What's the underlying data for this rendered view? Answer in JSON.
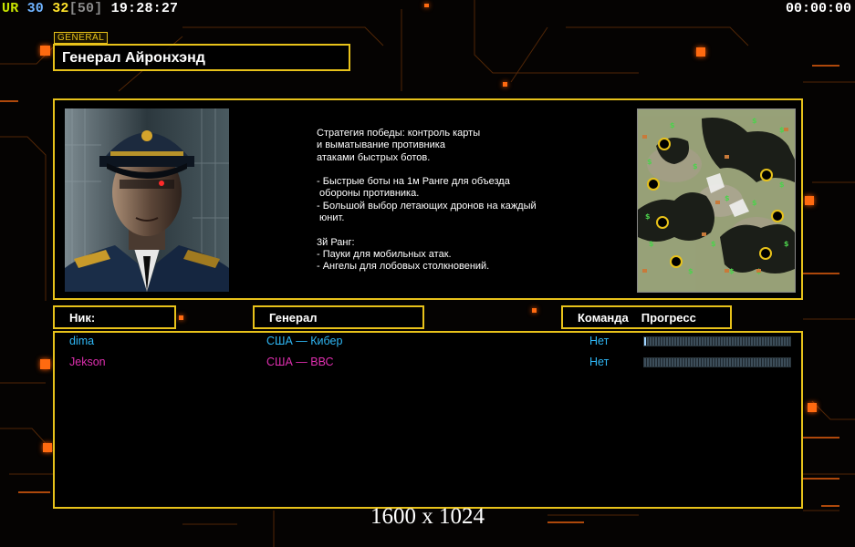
{
  "topbar": {
    "ur_label": "UR",
    "val_a": "30",
    "val_b": "32",
    "val_c": "[50]",
    "clock": "19:28:27",
    "timer": "00:00:00"
  },
  "general": {
    "tag": "GENERAL",
    "name": "Генерал Айронхэнд",
    "description": "Стратегия победы: контроль карты\nи выматывание противника\nатаками быстрых ботов.\n\n- Быстрые боты на 1м Ранге для объезда\n обороны противника.\n- Большой выбор летающих дронов на каждый\n юнит.\n\n3й Ранг:\n- Пауки для мобильных атак.\n- Ангелы для лобовых столкновений."
  },
  "columns": {
    "nick": "Ник:",
    "general": "Генерал",
    "team": "Команда",
    "progress": "Прогресс"
  },
  "players": [
    {
      "nick": "dima",
      "general": "США — Кибер",
      "team": "Нет",
      "progress": 0.01,
      "color": "#2fb7f5"
    },
    {
      "nick": "Jekson",
      "general": "США — ВВС",
      "team": "Нет",
      "progress": 0,
      "color": "#e02fb0"
    }
  ],
  "team_color": "#2fb7f5",
  "accent_color": "#e8c21a",
  "resolution_label": "1600 x 1024"
}
